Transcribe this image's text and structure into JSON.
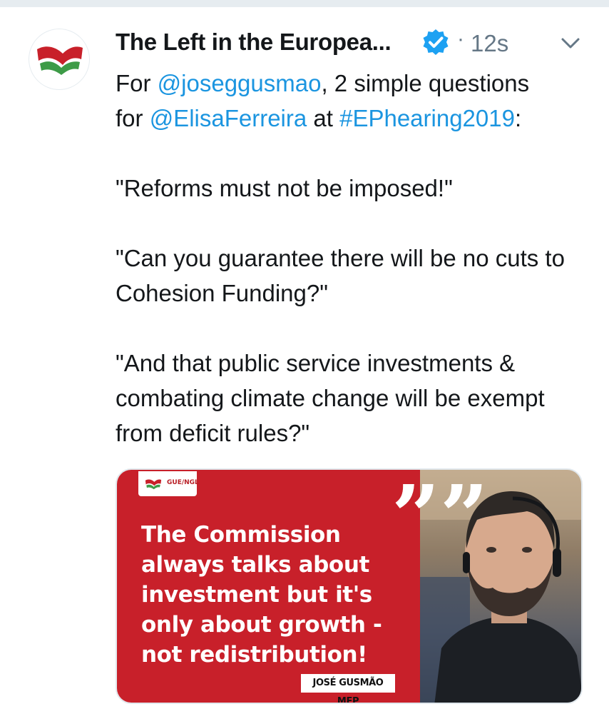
{
  "tweet": {
    "display_name": "The Left in the Europea...",
    "separator": "·",
    "timestamp": "12s",
    "text": {
      "line1_pre": "For ",
      "mention1": "@joseggusmao",
      "line1_post": ", 2 simple questions",
      "line2_pre": "for ",
      "mention2": "@ElisaFerreira",
      "line2_mid": " at ",
      "hashtag": "#EPhearing2019",
      "line2_post": ":",
      "para2": "\"Reforms must not be imposed!\"",
      "para3": "\"Can you guarantee there will be no cuts to Cohesion Funding?\"",
      "para4": "\"And that public service investments & combating climate change will be exempt from deficit rules?\""
    }
  },
  "media_card": {
    "badge_label": "GUE/NGL",
    "quote_text": "The Commission always talks about investment but it's only about growth - not redistribution!",
    "quote_marks": "””",
    "name_tag": "JOSÉ GUSMÃO MEP"
  },
  "icons": {
    "avatar": "party-flag-logo",
    "verified": "verified-badge-icon",
    "caret": "chevron-down-icon"
  },
  "colors": {
    "link": "#1b95e0",
    "verified": "#1da1f2",
    "card_red": "#c8202a",
    "muted": "#657786"
  }
}
